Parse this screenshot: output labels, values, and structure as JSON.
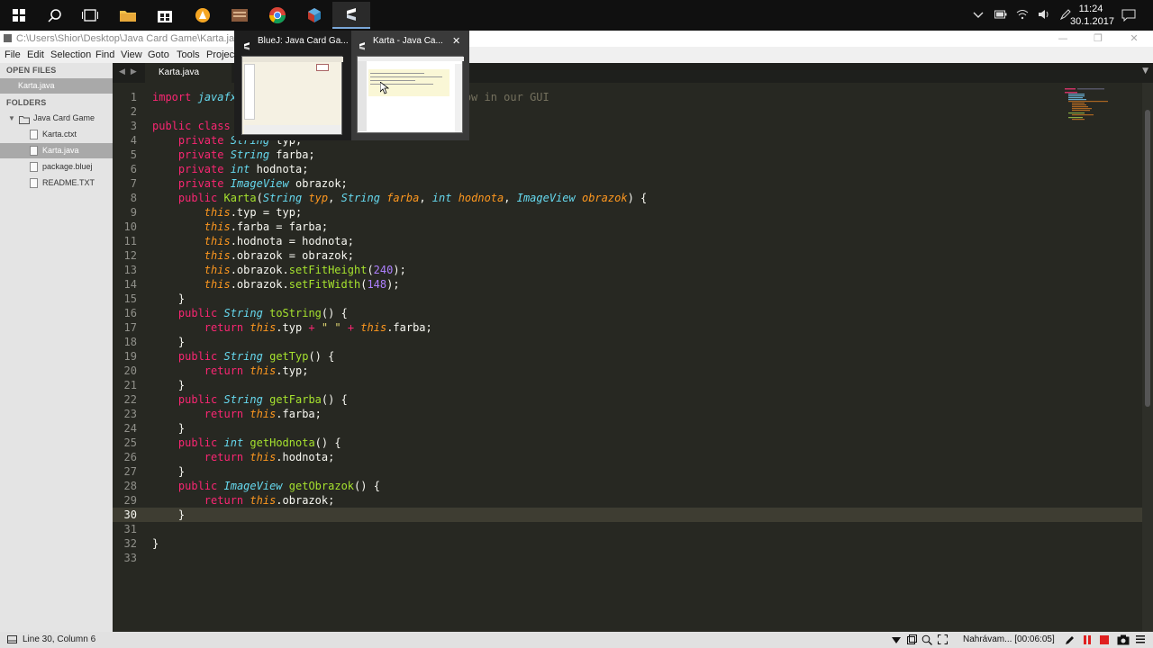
{
  "taskbar": {
    "clock_time": "11:24",
    "clock_date": "30.1.2017",
    "apps": [
      "start",
      "search",
      "task-view",
      "file-explorer",
      "store",
      "avast",
      "archive",
      "chrome",
      "dice-app",
      "sublime-text"
    ]
  },
  "window": {
    "title": "C:\\Users\\Shior\\Desktop\\Java Card Game\\Karta.java (Ja"
  },
  "menu": {
    "items": [
      "File",
      "Edit",
      "Selection",
      "Find",
      "View",
      "Goto",
      "Tools",
      "Project"
    ]
  },
  "sidebar": {
    "open_files_header": "OPEN FILES",
    "open_files": [
      "Karta.java"
    ],
    "folders_header": "FOLDERS",
    "folder_name": "Java Card Game",
    "files": [
      "Karta.ctxt",
      "Karta.java",
      "package.bluej",
      "README.TXT"
    ]
  },
  "tabs": {
    "active": "Karta.java"
  },
  "editor": {
    "line_numbers": [
      "1",
      "2",
      "3",
      "4",
      "5",
      "6",
      "7",
      "8",
      "9",
      "10",
      "11",
      "12",
      "13",
      "14",
      "15",
      "16",
      "17",
      "18",
      "19",
      "20",
      "21",
      "22",
      "23",
      "24",
      "25",
      "26",
      "27",
      "28",
      "29",
      "30",
      "31",
      "32",
      "33"
    ],
    "line1_kw": "import",
    "line1_pkg": "javafx",
    "line1_comment": "e to show in our GUI",
    "line3_kw": "public class"
  },
  "status": {
    "position": "Line 30, Column 6",
    "recording": "Nahrávam... [00:06:05]"
  },
  "preview": {
    "item1_title": "BlueJ: Java Card Ga...",
    "item2_title": "Karta - Java Ca..."
  },
  "colors": {
    "editor_bg": "#272822",
    "keyword": "#f92672",
    "type": "#66d9ef",
    "function": "#a6e22e",
    "param": "#fd971f",
    "number": "#ae81ff"
  }
}
